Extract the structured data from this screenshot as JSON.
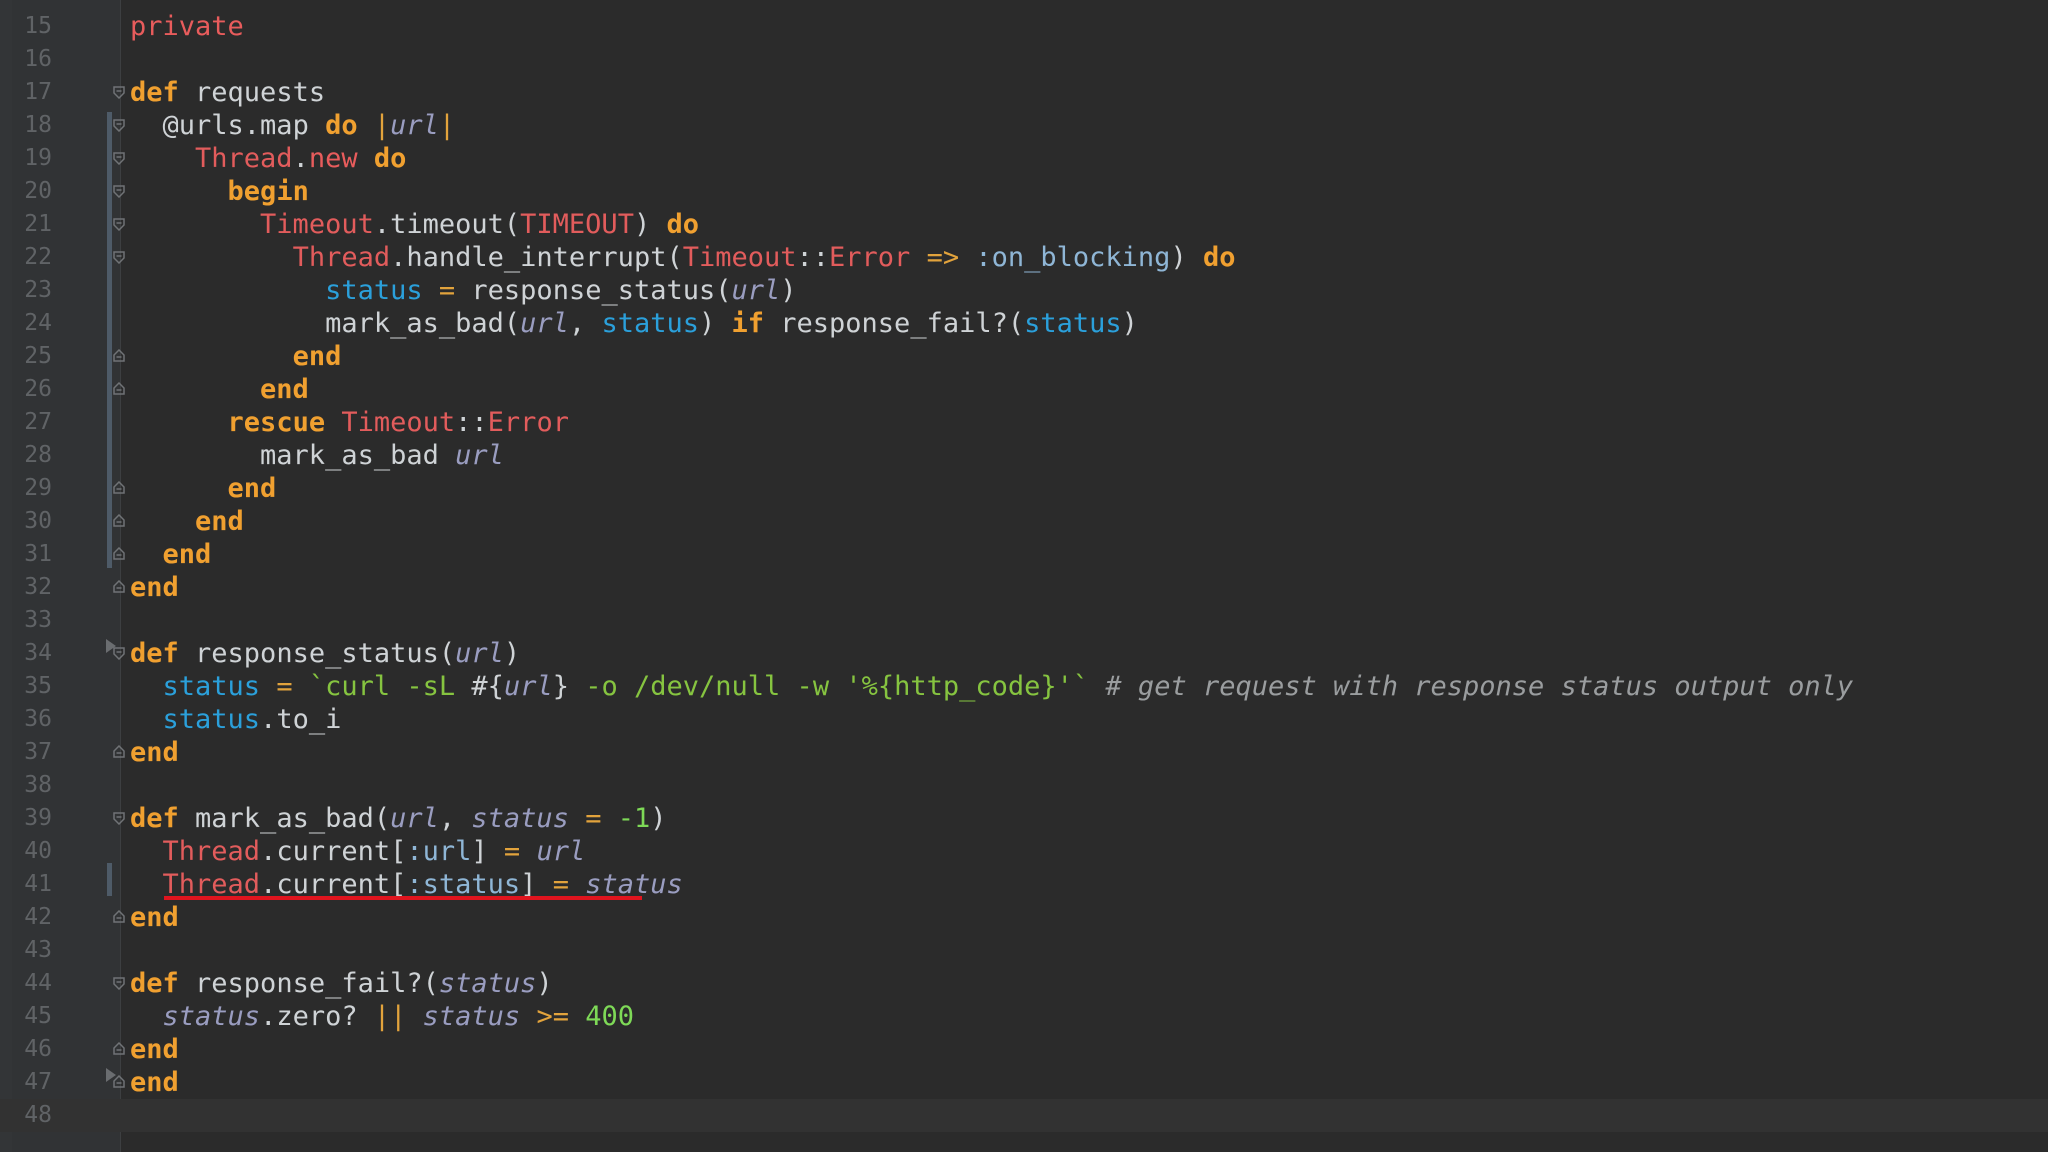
{
  "editor": {
    "language": "ruby",
    "current_line": 48,
    "colors": {
      "background": "#2b2b2b",
      "keyword": "#f0a030",
      "constant": "#e25c5c",
      "local_variable": "#2ba0db",
      "parameter": "#9a9dc0",
      "string": "#86c440",
      "comment": "#9a9d9f",
      "underline": "#e0141e"
    }
  },
  "lines": [
    {
      "n": "15",
      "code": "private"
    },
    {
      "n": "16",
      "code": ""
    },
    {
      "n": "17",
      "code": "def requests"
    },
    {
      "n": "18",
      "code": "  @urls.map do |url|"
    },
    {
      "n": "19",
      "code": "    Thread.new do"
    },
    {
      "n": "20",
      "code": "      begin"
    },
    {
      "n": "21",
      "code": "        Timeout.timeout(TIMEOUT) do"
    },
    {
      "n": "22",
      "code": "          Thread.handle_interrupt(Timeout::Error => :on_blocking) do"
    },
    {
      "n": "23",
      "code": "            status = response_status(url)"
    },
    {
      "n": "24",
      "code": "            mark_as_bad(url, status) if response_fail?(status)"
    },
    {
      "n": "25",
      "code": "          end"
    },
    {
      "n": "26",
      "code": "        end"
    },
    {
      "n": "27",
      "code": "      rescue Timeout::Error"
    },
    {
      "n": "28",
      "code": "        mark_as_bad url"
    },
    {
      "n": "29",
      "code": "      end"
    },
    {
      "n": "30",
      "code": "    end"
    },
    {
      "n": "31",
      "code": "  end"
    },
    {
      "n": "32",
      "code": "end"
    },
    {
      "n": "33",
      "code": ""
    },
    {
      "n": "34",
      "code": "def response_status(url)"
    },
    {
      "n": "35",
      "code": "  status = `curl -sL #{url} -o /dev/null -w '%{http_code}'` # get request with response status output only"
    },
    {
      "n": "36",
      "code": "  status.to_i"
    },
    {
      "n": "37",
      "code": "end"
    },
    {
      "n": "38",
      "code": ""
    },
    {
      "n": "39",
      "code": "def mark_as_bad(url, status = -1)"
    },
    {
      "n": "40",
      "code": "  Thread.current[:url] = url"
    },
    {
      "n": "41",
      "code": "  Thread.current[:status] = status"
    },
    {
      "n": "42",
      "code": "end"
    },
    {
      "n": "43",
      "code": ""
    },
    {
      "n": "44",
      "code": "def response_fail?(status)"
    },
    {
      "n": "45",
      "code": "  status.zero? || status >= 400"
    },
    {
      "n": "46",
      "code": "end"
    },
    {
      "n": "47",
      "code": "end"
    },
    {
      "n": "48",
      "code": ""
    }
  ]
}
